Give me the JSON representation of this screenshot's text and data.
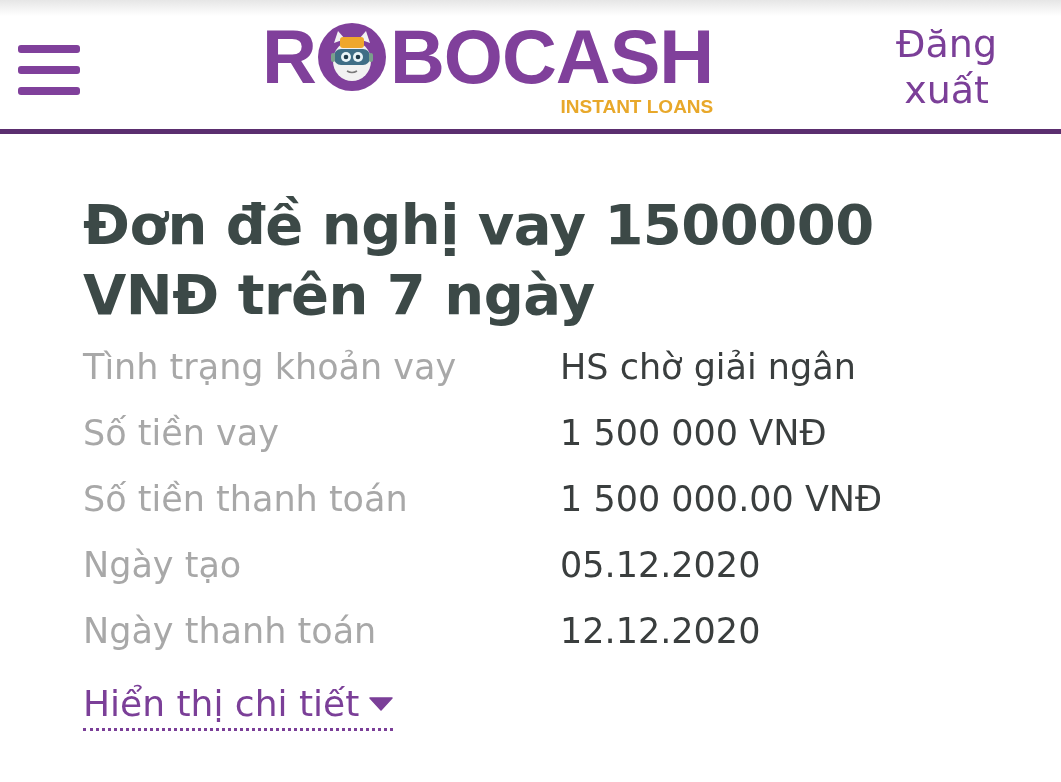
{
  "header": {
    "logo": {
      "lead": "R",
      "tail": "BOCASH",
      "tagline": "INSTANT LOANS"
    },
    "logout": "Đăng xuất"
  },
  "loan": {
    "title": "Đơn đề nghị vay 1500000 VNĐ trên 7 ngày",
    "details": [
      {
        "label": "Tình trạng khoản vay",
        "value": "HS chờ giải ngân"
      },
      {
        "label": "Số tiền vay",
        "value": "1 500 000 VNĐ"
      },
      {
        "label": "Số tiền thanh toán",
        "value": "1 500 000.00 VNĐ"
      },
      {
        "label": "Ngày tạo",
        "value": "05.12.2020"
      },
      {
        "label": "Ngày thanh toán",
        "value": "12.12.2020"
      }
    ],
    "details_link": "Hiển thị chi tiết"
  }
}
